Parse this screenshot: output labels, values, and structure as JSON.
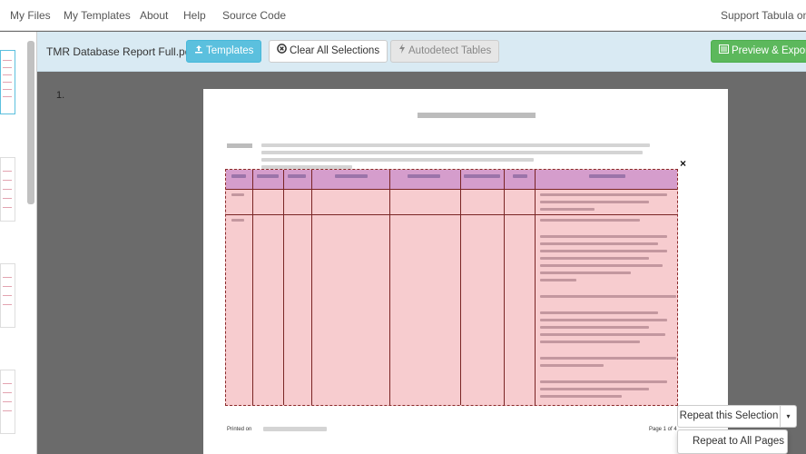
{
  "nav": {
    "my_files": "My Files",
    "my_templates": "My Templates",
    "about": "About",
    "help": "Help",
    "source_code": "Source Code",
    "support": "Support Tabula on Op"
  },
  "toolbar": {
    "filename": "TMR Database Report Full.pdf",
    "templates_label": "Templates",
    "clear_label": "Clear All Selections",
    "autodetect_label": "Autodetect Tables",
    "export_label": "Preview & Export D"
  },
  "page": {
    "number": "1.",
    "printed_on": "Printed on",
    "page_of": "Page 1 of 4"
  },
  "selection": {
    "close_symbol": "×",
    "repeat_label": "Repeat this Selection",
    "caret": "▾",
    "repeat_all_label": "Repeat to All Pages"
  },
  "colors": {
    "accent_info": "#5bc0de",
    "success": "#5cb85c",
    "selection_fill": "#eb7882",
    "header_fill": "#aa64c8"
  },
  "icons": {
    "templates": "upload-icon",
    "clear": "remove-circle-icon",
    "autodetect": "flash-icon",
    "export": "list-alt-icon"
  }
}
